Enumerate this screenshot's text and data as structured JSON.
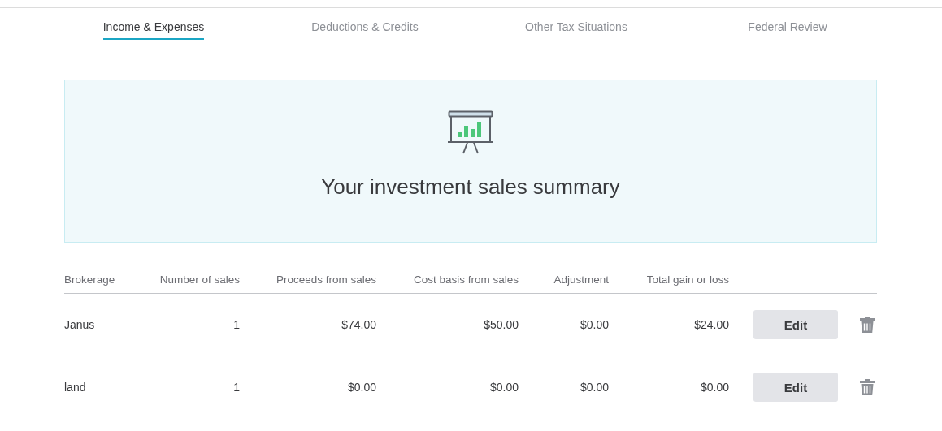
{
  "tabs": [
    {
      "label": "Income & Expenses",
      "selected": true
    },
    {
      "label": "Deductions & Credits",
      "selected": false
    },
    {
      "label": "Other Tax Situations",
      "selected": false
    },
    {
      "label": "Federal Review",
      "selected": false
    }
  ],
  "banner": {
    "title": "Your investment sales summary"
  },
  "table": {
    "columns": [
      "Brokerage",
      "Number of sales",
      "Proceeds from sales",
      "Cost basis from sales",
      "Adjustment",
      "Total gain or loss"
    ],
    "rows": [
      {
        "cells": [
          "Janus",
          "1",
          "$74.00",
          "$50.00",
          "$0.00",
          "$24.00"
        ],
        "action": "Edit"
      },
      {
        "cells": [
          "land",
          "1",
          "$0.00",
          "$0.00",
          "$0.00",
          "$0.00"
        ],
        "action": "Edit"
      }
    ]
  }
}
